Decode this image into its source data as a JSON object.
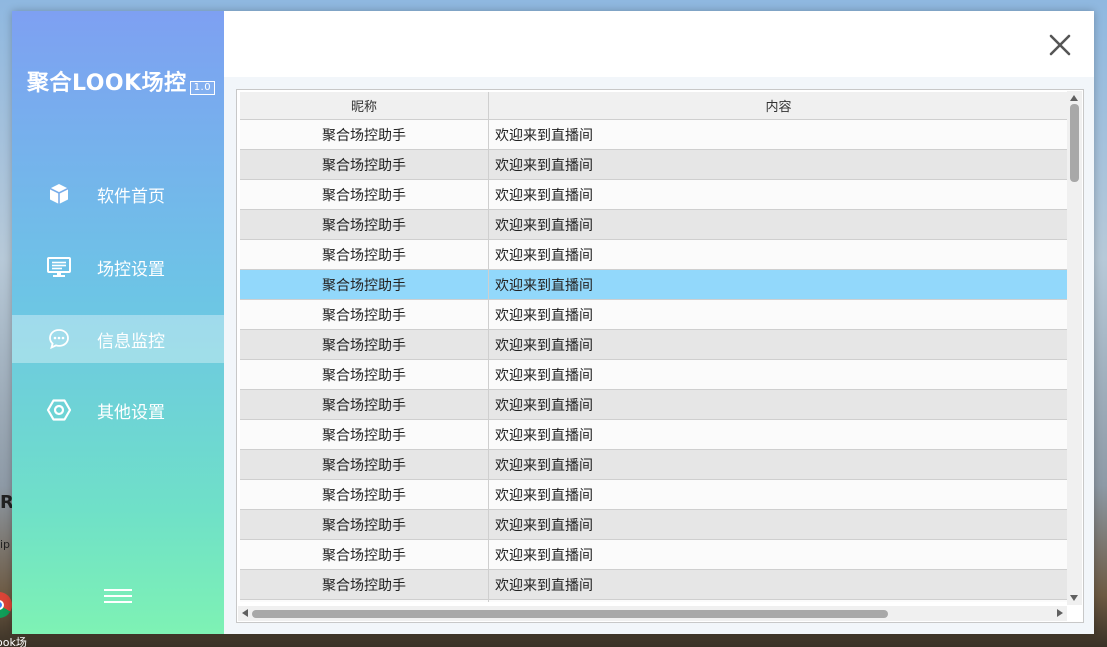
{
  "app": {
    "title": "聚合LOOK场控",
    "version": "1.0"
  },
  "sidebar": {
    "items": [
      {
        "label": "软件首页",
        "icon": "cube-icon",
        "active": false
      },
      {
        "label": "场控设置",
        "icon": "monitor-icon",
        "active": false
      },
      {
        "label": "信息监控",
        "icon": "chat-bubble-icon",
        "active": true
      },
      {
        "label": "其他设置",
        "icon": "hexagon-nut-icon",
        "active": false
      }
    ],
    "menu_icon": "hamburger-icon"
  },
  "topbar": {
    "close_icon": "close-icon"
  },
  "table": {
    "columns": [
      "昵称",
      "内容"
    ],
    "rows": [
      [
        "聚合场控助手",
        "欢迎来到直播间"
      ],
      [
        "聚合场控助手",
        "欢迎来到直播间"
      ],
      [
        "聚合场控助手",
        "欢迎来到直播间"
      ],
      [
        "聚合场控助手",
        "欢迎来到直播间"
      ],
      [
        "聚合场控助手",
        "欢迎来到直播间"
      ],
      [
        "聚合场控助手",
        "欢迎来到直播间"
      ],
      [
        "聚合场控助手",
        "欢迎来到直播间"
      ],
      [
        "聚合场控助手",
        "欢迎来到直播间"
      ],
      [
        "聚合场控助手",
        "欢迎来到直播间"
      ],
      [
        "聚合场控助手",
        "欢迎来到直播间"
      ],
      [
        "聚合场控助手",
        "欢迎来到直播间"
      ],
      [
        "聚合场控助手",
        "欢迎来到直播间"
      ],
      [
        "聚合场控助手",
        "欢迎来到直播间"
      ],
      [
        "聚合场控助手",
        "欢迎来到直播间"
      ],
      [
        "聚合场控助手",
        "欢迎来到直播间"
      ],
      [
        "聚合场控助手",
        "欢迎来到直播间"
      ]
    ],
    "selected_row": 5
  },
  "desktop": {
    "fragments": [
      "R",
      "ip",
      "ook场"
    ]
  },
  "colors": {
    "selected_row": "#92d8fb",
    "row_alt": "#e6e6e6",
    "sidebar_top": "#7ea0f2",
    "sidebar_bottom": "#7ef2b4"
  }
}
